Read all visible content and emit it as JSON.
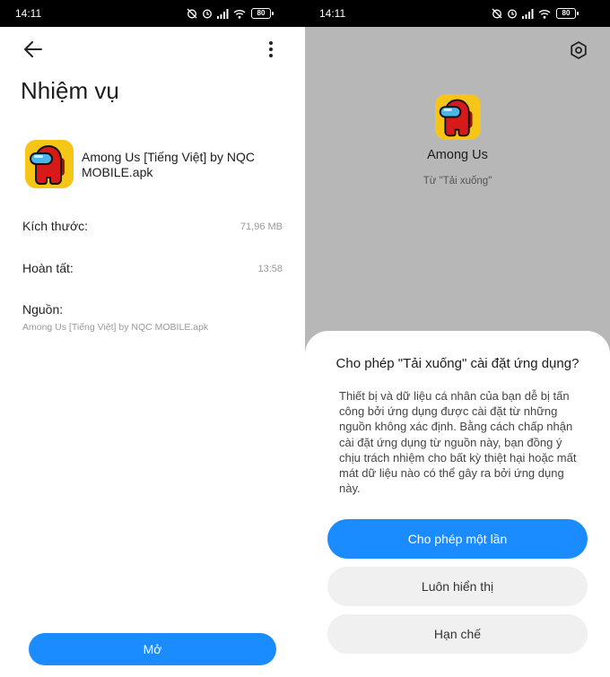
{
  "left": {
    "status": {
      "time": "14:11",
      "battery": "80"
    },
    "title": "Nhiệm vụ",
    "file_name": "Among Us [Tiếng Việt] by NQC MOBILE.apk",
    "rows": {
      "size_label": "Kích thước:",
      "size_value": "71,96 MB",
      "done_label": "Hoàn tất:",
      "done_value": "13:58",
      "source_label": "Nguồn:",
      "source_value": "Among Us [Tiếng Việt] by NQC MOBILE.apk"
    },
    "open_label": "Mở"
  },
  "right": {
    "status": {
      "time": "14:11",
      "battery": "80"
    },
    "app_name": "Among Us",
    "app_source": "Từ \"Tải xuống\"",
    "dialog": {
      "title": "Cho phép \"Tải xuống\" cài đặt ứng dụng?",
      "body": "Thiết bị và dữ liệu cá nhân của bạn dễ bị tấn công bởi ứng dụng được cài đặt từ những nguồn không xác định. Bằng cách chấp nhận cài đặt ứng dụng từ nguồn này, bạn đồng ý chịu trách nhiệm cho bất kỳ thiệt hại hoặc mất mát dữ liệu nào có thể gây ra bởi ứng dụng này.",
      "allow_once": "Cho phép một lần",
      "always_show": "Luôn hiển thị",
      "restrict": "Hạn chế"
    }
  },
  "colors": {
    "accent": "#1a8cff",
    "scrim": "#b7b7b7",
    "icon_bg": "#f5c518",
    "crewmate": "#d61a1a",
    "visor": "#4fb4e6"
  },
  "icons": [
    "back-arrow-icon",
    "more-vertical-icon",
    "settings-hexagon-icon",
    "among-us-app-icon",
    "alarm-off-icon",
    "alarm-icon",
    "signal-icon",
    "wifi-icon",
    "battery-icon"
  ]
}
